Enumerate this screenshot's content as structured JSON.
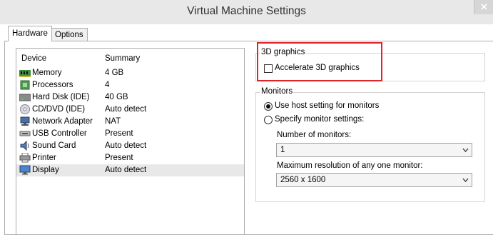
{
  "window": {
    "title": "Virtual Machine Settings"
  },
  "tabs": [
    {
      "label": "Hardware",
      "active": true
    },
    {
      "label": "Options",
      "active": false
    }
  ],
  "device_list": {
    "columns": [
      "Device",
      "Summary"
    ],
    "rows": [
      {
        "device": "Memory",
        "summary": "4 GB",
        "icon": "memory-icon"
      },
      {
        "device": "Processors",
        "summary": "4",
        "icon": "processor-icon"
      },
      {
        "device": "Hard Disk (IDE)",
        "summary": "40 GB",
        "icon": "hard-disk-icon"
      },
      {
        "device": "CD/DVD (IDE)",
        "summary": "Auto detect",
        "icon": "cd-dvd-icon"
      },
      {
        "device": "Network Adapter",
        "summary": "NAT",
        "icon": "network-adapter-icon"
      },
      {
        "device": "USB Controller",
        "summary": "Present",
        "icon": "usb-icon"
      },
      {
        "device": "Sound Card",
        "summary": "Auto detect",
        "icon": "sound-card-icon"
      },
      {
        "device": "Printer",
        "summary": "Present",
        "icon": "printer-icon"
      },
      {
        "device": "Display",
        "summary": "Auto detect",
        "icon": "display-icon",
        "selected": true
      }
    ]
  },
  "graphics_3d": {
    "group_label": "3D graphics",
    "accelerate_label": "Accelerate 3D graphics",
    "accelerate_checked": false
  },
  "monitors": {
    "group_label": "Monitors",
    "use_host_label": "Use host setting for monitors",
    "use_host_selected": true,
    "specify_label": "Specify monitor settings:",
    "specify_selected": false,
    "number_label": "Number of monitors:",
    "number_value": "1",
    "max_resolution_label": "Maximum resolution of any one monitor:",
    "max_resolution_value": "2560 x 1600"
  },
  "colors": {
    "highlight_border": "#e0242b",
    "selected_row": "#e8e8e8"
  }
}
